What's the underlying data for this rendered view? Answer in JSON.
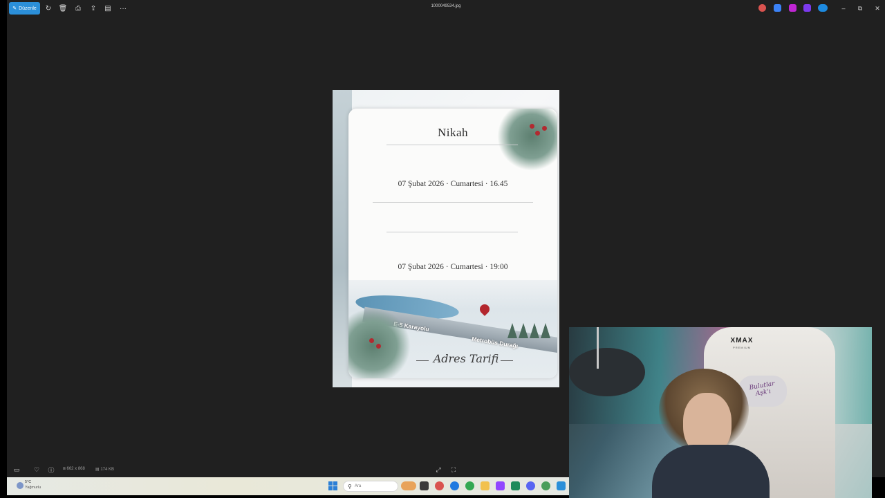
{
  "toolbar": {
    "edit_label": "Düzenle",
    "filename": "1000049534.jpg"
  },
  "invitation": {
    "title": "Nikah",
    "event1": "07 Şubat 2026 · Cumartesi · 16.45",
    "event2": "07 Şubat 2026 · Cumartesi · 19:00",
    "road_label": "E-5 Karayolu",
    "stop_label": "Metrobüs Durağı",
    "directions": "Adres Tarifi"
  },
  "statusbar": {
    "dimensions": "662 x 868",
    "filesize": "174 KB"
  },
  "taskbar": {
    "weather_temp": "5°C",
    "weather_condition": "Yağmurlu",
    "search_placeholder": "Ara"
  },
  "webcam": {
    "chair_brand": "XMAX",
    "chair_sub": "PREMIUM",
    "pillow_text": "Bulutlar Aşk'ı"
  },
  "colors": {
    "accent": "#2b8fd9",
    "background": "#202020"
  }
}
